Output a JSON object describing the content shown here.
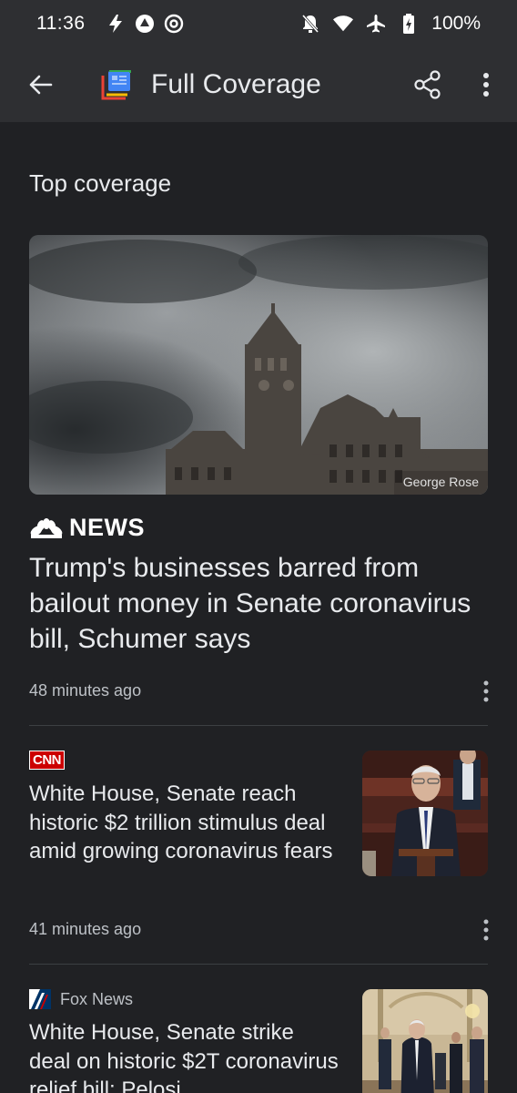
{
  "status_bar": {
    "time": "11:36",
    "battery": "100%"
  },
  "app_bar": {
    "title": "Full Coverage"
  },
  "section": {
    "title": "Top coverage"
  },
  "articles": [
    {
      "source": "NEWS",
      "headline": "Trump's businesses barred from bailout money in Senate coronavirus bill, Schumer says",
      "time": "48 minutes ago",
      "image_credit": "George Rose"
    },
    {
      "source": "CNN",
      "headline": "White House, Senate reach historic $2 trillion stimulus deal amid growing coronavirus fears",
      "time": "41 minutes ago"
    },
    {
      "source": "Fox News",
      "headline": "White House, Senate strike deal on historic $2T coronavirus relief bill; Pelosi"
    }
  ],
  "colors": {
    "background": "#202124",
    "toolbar": "#2e2f32",
    "text_primary": "#e8eaed",
    "text_secondary": "#bdc1c6"
  }
}
